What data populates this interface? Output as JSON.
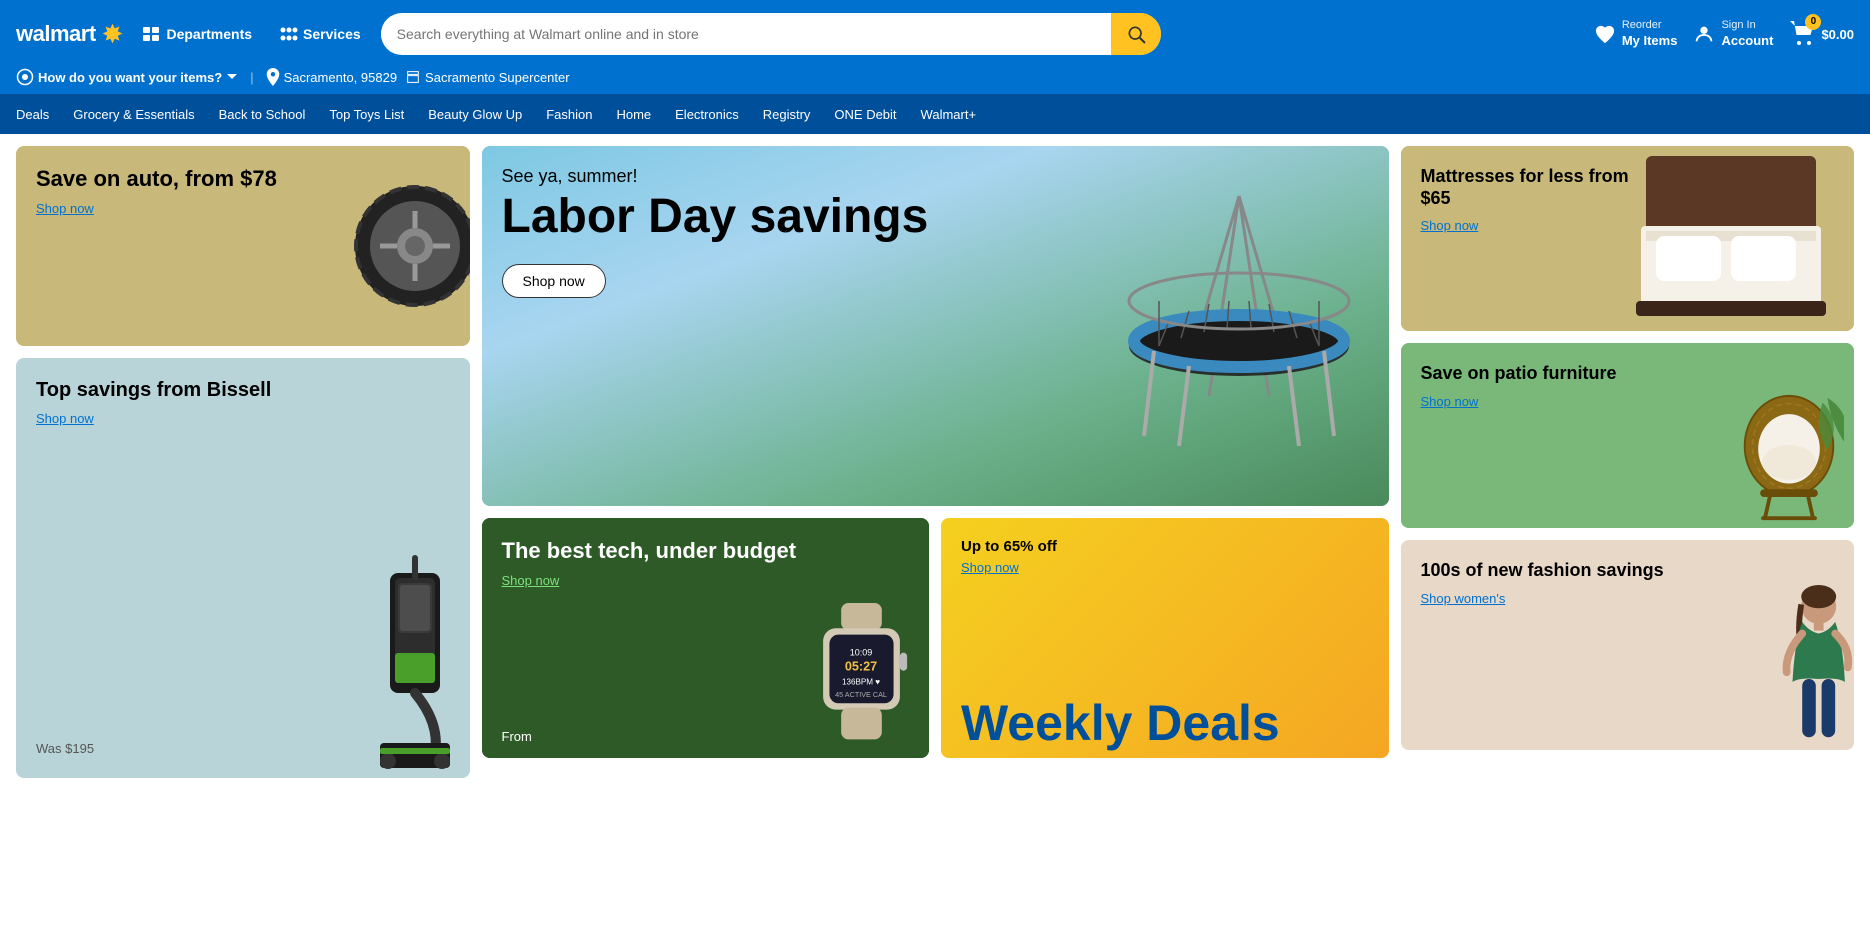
{
  "header": {
    "logo_text": "walmart",
    "spark": "✦",
    "departments_label": "Departments",
    "services_label": "Services",
    "search_placeholder": "Search everything at Walmart online and in store",
    "reorder_top": "Reorder",
    "reorder_bottom": "My Items",
    "signin_top": "Sign In",
    "signin_bottom": "Account",
    "cart_price": "$0.00",
    "cart_count": "0"
  },
  "subheader": {
    "delivery_label": "How do you want your items?",
    "location_zip": "Sacramento, 95829",
    "store_name": "Sacramento Supercenter"
  },
  "navbar": {
    "items": [
      "Deals",
      "Grocery & Essentials",
      "Back to School",
      "Top Toys List",
      "Beauty Glow Up",
      "Fashion",
      "Home",
      "Electronics",
      "Registry",
      "ONE Debit",
      "Walmart+"
    ]
  },
  "promos": {
    "auto": {
      "title": "Save on auto, from $78",
      "link": "Shop now"
    },
    "bissell": {
      "title": "Top savings from Bissell",
      "link": "Shop now",
      "was_price": "Was $195"
    },
    "labor_day": {
      "subtitle": "See ya, summer!",
      "title": "Labor Day savings",
      "btn": "Shop now"
    },
    "tech": {
      "title": "The best tech, under budget",
      "link": "Shop now",
      "from_label": "From"
    },
    "weekly": {
      "title": "Up to 65% off",
      "link": "Shop now",
      "big_text": "Weekly Deals"
    },
    "mattress": {
      "title": "Mattresses for less from $65",
      "link": "Shop now"
    },
    "patio": {
      "title": "Save on patio furniture",
      "link": "Shop now"
    },
    "fashion": {
      "title": "100s of new fashion savings",
      "link": "Shop women's"
    }
  }
}
